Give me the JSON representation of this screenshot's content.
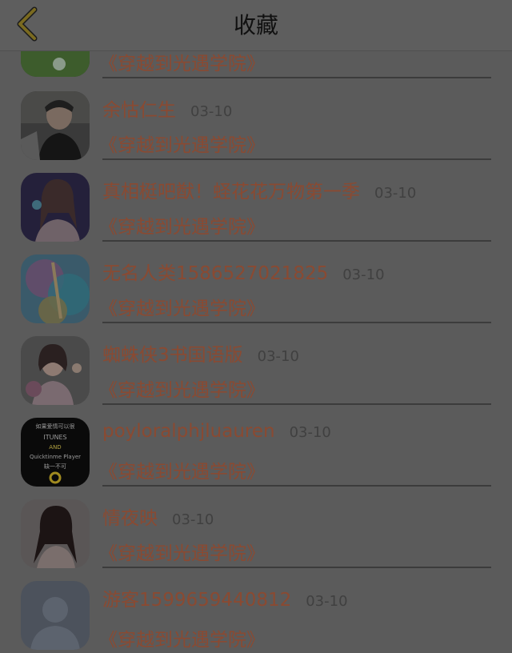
{
  "header": {
    "title": "收藏"
  },
  "colors": {
    "accent": "#8a4a32",
    "overlay": "#5b5b5b",
    "back_arrow": "#7a6a20"
  },
  "items": [
    {
      "name": "",
      "date": "",
      "book": "《穿越到光遇学院》",
      "avatar": "landscape"
    },
    {
      "name": "余怙仁生",
      "date": "03-10",
      "book": "《穿越到光遇学院》",
      "avatar": "boy-photo"
    },
    {
      "name": "真相梃吧猷！蛏花花万物第一季",
      "date": "03-10",
      "book": "《穿越到光遇学院》",
      "avatar": "girl-photo"
    },
    {
      "name": "无名人类1586527021825",
      "date": "03-10",
      "book": "《穿越到光遇学院》",
      "avatar": "painting"
    },
    {
      "name": "蜘蛛侠3书国语版",
      "date": "03-10",
      "book": "《穿越到光遇学院》",
      "avatar": "girl-flowers"
    },
    {
      "name": "poyloralphjluauren",
      "date": "03-10",
      "book": "《穿越到光遇学院》",
      "avatar": "itunes-logo",
      "avatar_text": [
        "如果爱情可以很",
        "ITUNES",
        "AND",
        "Quicktinme Player",
        "缺一不可"
      ]
    },
    {
      "name": "情夜映",
      "date": "03-10",
      "book": "《穿越到光遇学院》",
      "avatar": "woman-portrait"
    },
    {
      "name": "游客1599659440812",
      "date": "03-10",
      "book": "《穿越到光遇学院》",
      "avatar": "default-user"
    }
  ]
}
